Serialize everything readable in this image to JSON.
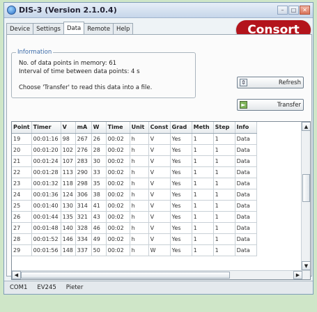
{
  "window": {
    "title": "DIS-3 (Version 2.1.0.4)"
  },
  "tabs": [
    "Device",
    "Settings",
    "Data",
    "Remote",
    "Help"
  ],
  "active_tab": "Data",
  "brand": {
    "logo_text": "Consort",
    "color": "#b3141c"
  },
  "info": {
    "legend": "Information",
    "points_line": "No. of data points in memory: 61",
    "interval_line": "Interval of time between data points: 4 s",
    "hint_line": "Choose 'Transfer' to read this data into a file."
  },
  "buttons": {
    "refresh": "Refresh",
    "transfer": "Transfer"
  },
  "table": {
    "columns": [
      "Point",
      "Timer",
      "V",
      "mA",
      "W",
      "Time",
      "Unit",
      "Const",
      "Grad",
      "Meth",
      "Step",
      "Info"
    ],
    "rows": [
      [
        "19",
        "00:01:16",
        "98",
        "267",
        "26",
        "00:02",
        "h",
        "V",
        "Yes",
        "1",
        "1",
        "Data"
      ],
      [
        "20",
        "00:01:20",
        "102",
        "276",
        "28",
        "00:02",
        "h",
        "V",
        "Yes",
        "1",
        "1",
        "Data"
      ],
      [
        "21",
        "00:01:24",
        "107",
        "283",
        "30",
        "00:02",
        "h",
        "V",
        "Yes",
        "1",
        "1",
        "Data"
      ],
      [
        "22",
        "00:01:28",
        "113",
        "290",
        "33",
        "00:02",
        "h",
        "V",
        "Yes",
        "1",
        "1",
        "Data"
      ],
      [
        "23",
        "00:01:32",
        "118",
        "298",
        "35",
        "00:02",
        "h",
        "V",
        "Yes",
        "1",
        "1",
        "Data"
      ],
      [
        "24",
        "00:01:36",
        "124",
        "306",
        "38",
        "00:02",
        "h",
        "V",
        "Yes",
        "1",
        "1",
        "Data"
      ],
      [
        "25",
        "00:01:40",
        "130",
        "314",
        "41",
        "00:02",
        "h",
        "V",
        "Yes",
        "1",
        "1",
        "Data"
      ],
      [
        "26",
        "00:01:44",
        "135",
        "321",
        "43",
        "00:02",
        "h",
        "V",
        "Yes",
        "1",
        "1",
        "Data"
      ],
      [
        "27",
        "00:01:48",
        "140",
        "328",
        "46",
        "00:02",
        "h",
        "V",
        "Yes",
        "1",
        "1",
        "Data"
      ],
      [
        "28",
        "00:01:52",
        "146",
        "334",
        "49",
        "00:02",
        "h",
        "V",
        "Yes",
        "1",
        "1",
        "Data"
      ],
      [
        "29",
        "00:01:56",
        "148",
        "337",
        "50",
        "00:02",
        "h",
        "W",
        "Yes",
        "1",
        "1",
        "Data"
      ]
    ]
  },
  "status": {
    "port": "COM1",
    "device": "EV245",
    "user": "Pieter"
  }
}
